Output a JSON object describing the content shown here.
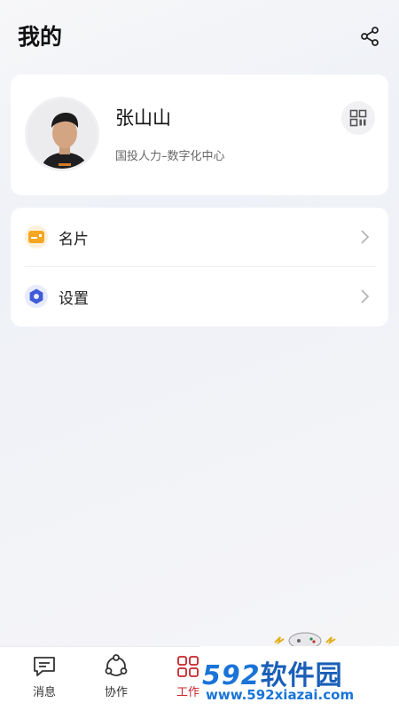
{
  "header": {
    "title": "我的",
    "share_icon": "share-icon"
  },
  "profile": {
    "name": "张山山",
    "organization": "国投人力–数字化中心",
    "qr_icon": "qr-code-icon"
  },
  "menu": {
    "items": [
      {
        "label": "名片",
        "icon": "business-card-icon",
        "color": "#f5a623"
      },
      {
        "label": "设置",
        "icon": "gear-icon",
        "color": "#3f5bd8"
      }
    ]
  },
  "tabbar": {
    "tabs": [
      {
        "label": "消息",
        "icon": "message-icon"
      },
      {
        "label": "协作",
        "icon": "collaboration-icon"
      },
      {
        "label": "工作",
        "icon": "workbench-icon",
        "active": true
      }
    ],
    "active_color": "#c8242a"
  },
  "watermark": {
    "main_digits": "592",
    "main_cn": "软件园",
    "url": "www.592xiazai.com"
  }
}
